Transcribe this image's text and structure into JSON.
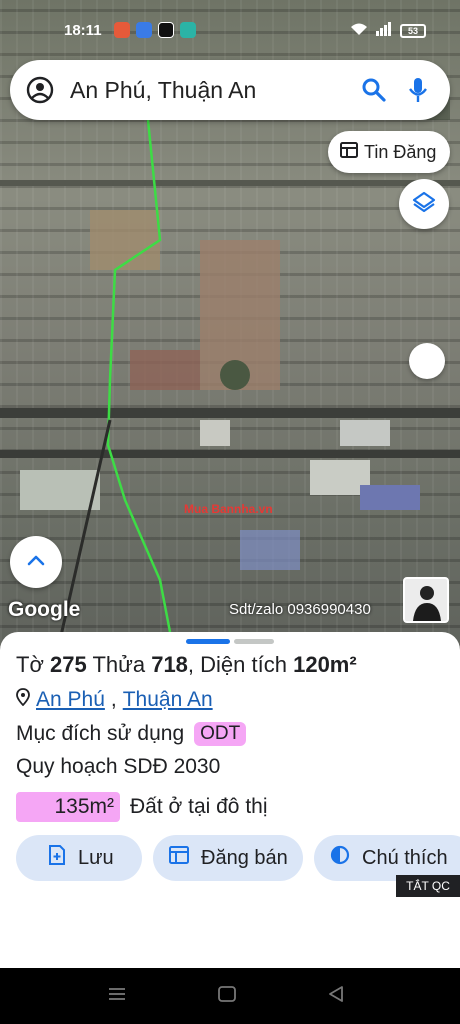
{
  "status_bar": {
    "time": "18:11",
    "battery": "53"
  },
  "search": {
    "query": "An Phú, Thuận An"
  },
  "tin_dang": {
    "label": "Tin Đăng"
  },
  "map": {
    "attribution": "Google",
    "contact": "Sdt/zalo 0936990430",
    "watermark": "Mua Bannha.vn"
  },
  "parcel": {
    "to_label": "Tờ",
    "to_value": "275",
    "thua_label": "Thửa",
    "thua_value": "718",
    "dientich_label": ", Diện tích",
    "dientich_value": "120m²",
    "ward": "An Phú",
    "separator": ",",
    "district": "Thuận An",
    "purpose_label": "Mục đích sử dụng",
    "purpose_code": "ODT",
    "plan_label": "Quy hoạch SDĐ 2030",
    "plan_area": "135m²",
    "plan_desc": "Đất ở tại đô thị"
  },
  "actions": {
    "save": "Lưu",
    "sell": "Đăng bán",
    "legend": "Chú thích"
  },
  "ad": {
    "label": "TẮT QC"
  },
  "colors": {
    "accent": "#1a73e8",
    "highlight": "#f5a6f5",
    "action_bg": "#dbe6f7",
    "route": "#3ddc45"
  }
}
